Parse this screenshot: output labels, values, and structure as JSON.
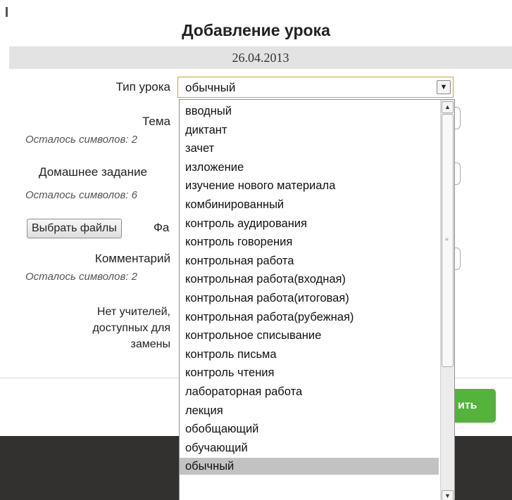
{
  "dialog": {
    "title": "Добавление урока",
    "date": "26.04.2013"
  },
  "form": {
    "lesson_type_label": "Тип урока",
    "topic_label": "Тема",
    "topic_hint": "Осталось символов: 2",
    "homework_label": "Домашнее задание",
    "homework_hint": "Осталось символов: 6",
    "choose_files_label": "Выбрать файлы",
    "file_label_partial": "Фа",
    "comment_label": "Комментарий",
    "comment_hint": "Осталось символов: 2",
    "no_teachers_line1": "Нет учителей,",
    "no_teachers_line2": "доступных для",
    "no_teachers_line3": "замены"
  },
  "select": {
    "value": "обычный",
    "options": [
      "вводный",
      "диктант",
      "зачет",
      "изложение",
      "изучение нового материала",
      "комбинированный",
      "контроль аудирования",
      "контроль говорения",
      "контрольная работа",
      "контрольная работа(входная)",
      "контрольная работа(итоговая)",
      "контрольная работа(рубежная)",
      "контрольное списывание",
      "контроль письма",
      "контроль чтения",
      "лабораторная работа",
      "лекция",
      "обобщающий",
      "обучающий",
      "обычный"
    ],
    "selected_index": 19
  },
  "footer": {
    "save_label_partial": "ить"
  },
  "icons": {
    "dropdown_arrow": "chevron-down-icon",
    "scroll_up": "chevron-up-icon",
    "scroll_down": "chevron-down-icon"
  },
  "colors": {
    "accent_button": "#53b33b",
    "select_focus_border": "#d89b30",
    "selected_option": "#c2c2c2"
  }
}
